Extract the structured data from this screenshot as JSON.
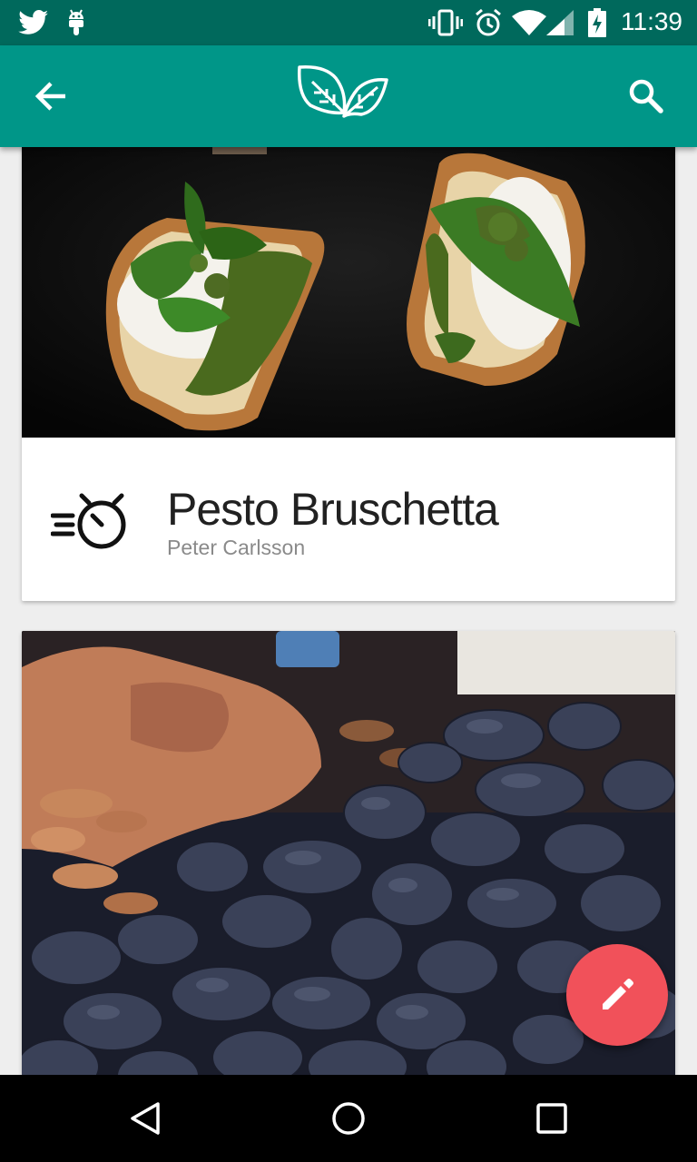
{
  "status_bar": {
    "time": "11:39",
    "icons": [
      "twitter-icon",
      "android-icon",
      "vibrate-icon",
      "alarm-icon",
      "wifi-icon",
      "signal-icon",
      "battery-charging-icon"
    ]
  },
  "app_bar": {
    "back_icon": "arrow-back-icon",
    "logo_icon": "leaves-logo-icon",
    "search_icon": "search-icon"
  },
  "recipes": [
    {
      "title": "Pesto Bruschetta",
      "author": "Peter Carlsson",
      "icon": "quick-timer-icon"
    },
    {
      "title": "",
      "author": "",
      "image": "purple-potatoes-photo"
    }
  ],
  "fab": {
    "icon": "edit-pencil-icon",
    "color": "#f1515a"
  },
  "nav_bar": {
    "icons": [
      "back-triangle-icon",
      "home-circle-icon",
      "recents-square-icon"
    ]
  },
  "colors": {
    "primary": "#009688",
    "primary_dark": "#00695c",
    "accent": "#f1515a"
  }
}
